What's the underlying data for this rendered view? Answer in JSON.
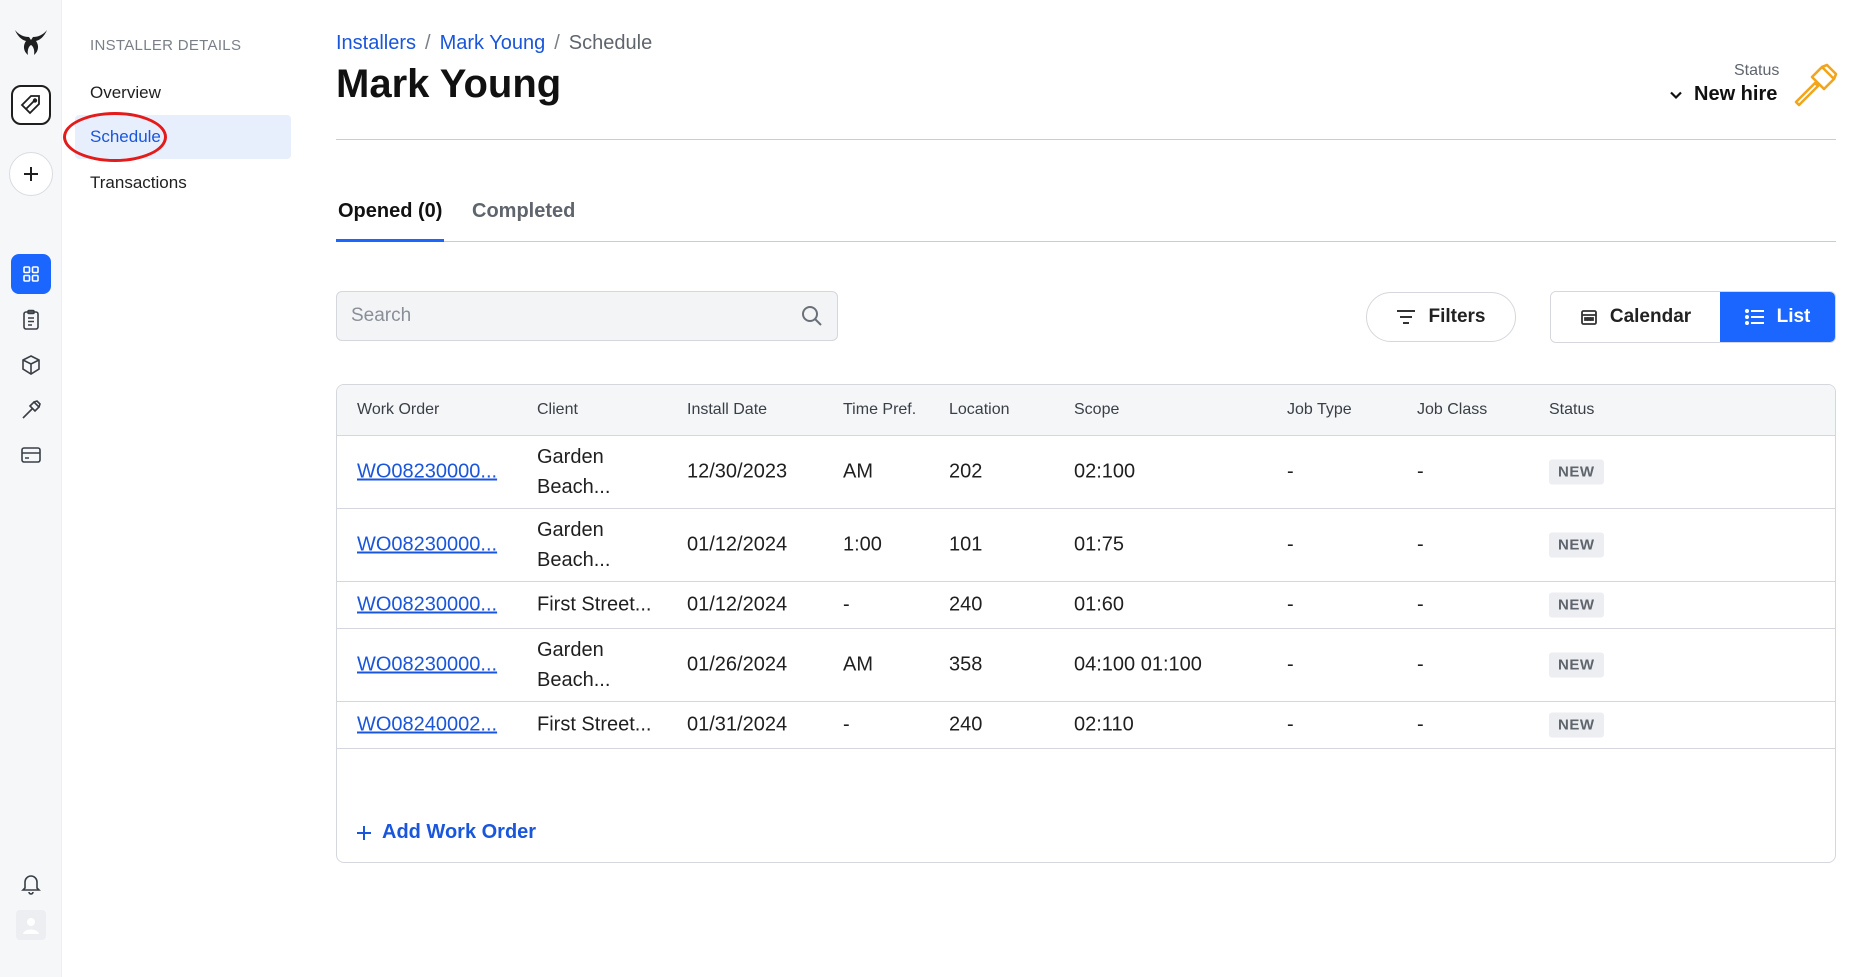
{
  "subnav": {
    "title": "INSTALLER DETAILS",
    "items": [
      {
        "label": "Overview"
      },
      {
        "label": "Schedule"
      },
      {
        "label": "Transactions"
      }
    ]
  },
  "breadcrumb": {
    "items": [
      "Installers",
      "Mark Young",
      "Schedule"
    ],
    "separator": "/"
  },
  "page": {
    "title": "Mark Young"
  },
  "status": {
    "label": "Status",
    "value": "New hire",
    "accent_color": "#f2a51c"
  },
  "tabs": [
    {
      "label": "Opened (0)",
      "active": true
    },
    {
      "label": "Completed",
      "active": false
    }
  ],
  "search": {
    "placeholder": "Search",
    "value": ""
  },
  "toolbar": {
    "filters_label": "Filters",
    "calendar_label": "Calendar",
    "list_label": "List",
    "active_view": "List"
  },
  "table": {
    "columns": [
      "Work Order",
      "Client",
      "Install Date",
      "Time Pref.",
      "Location",
      "Scope",
      "Job Type",
      "Job Class",
      "Status"
    ],
    "rows": [
      {
        "work_order": "WO08230000...",
        "client": "Garden Beach...",
        "install_date": "12/30/2023",
        "time_pref": "AM",
        "location": "202",
        "scope": "02:100",
        "job_type": "-",
        "job_class": "-",
        "status": "NEW"
      },
      {
        "work_order": "WO08230000...",
        "client": "Garden Beach...",
        "install_date": "01/12/2024",
        "time_pref": "1:00",
        "location": "101",
        "scope": "01:75",
        "job_type": "-",
        "job_class": "-",
        "status": "NEW"
      },
      {
        "work_order": "WO08230000...",
        "client": "First Street...",
        "install_date": "01/12/2024",
        "time_pref": "-",
        "location": "240",
        "scope": "01:60",
        "job_type": "-",
        "job_class": "-",
        "status": "NEW"
      },
      {
        "work_order": "WO08230000...",
        "client": "Garden Beach...",
        "install_date": "01/26/2024",
        "time_pref": "AM",
        "location": "358",
        "scope": "04:100 01:100",
        "job_type": "-",
        "job_class": "-",
        "status": "NEW"
      },
      {
        "work_order": "WO08240002...",
        "client": "First Street...",
        "install_date": "01/31/2024",
        "time_pref": "-",
        "location": "240",
        "scope": "02:110",
        "job_type": "-",
        "job_class": "-",
        "status": "NEW"
      }
    ],
    "add_label": "Add Work Order"
  },
  "colors": {
    "primary": "#1a66ff",
    "link": "#1a56db",
    "annotation": "#e31b1b"
  }
}
